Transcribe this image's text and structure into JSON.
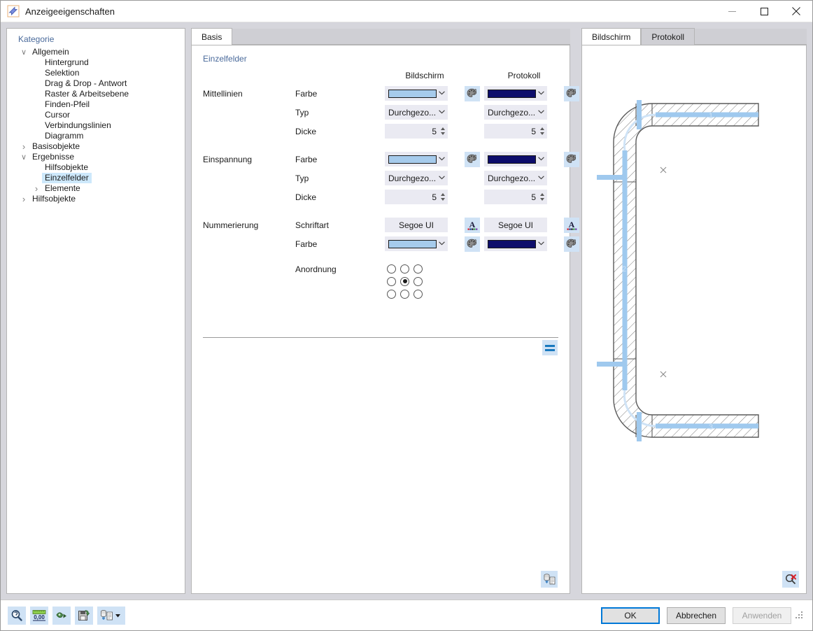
{
  "window": {
    "title": "Anzeigeeigenschaften",
    "app_icon": "arrow-app-icon",
    "minimize_label": "–",
    "maximize_label": "□",
    "close_label": "✕"
  },
  "sidebar": {
    "header": "Kategorie",
    "items": [
      {
        "label": "Allgemein",
        "indent": 0,
        "chevron": "down",
        "selected": false
      },
      {
        "label": "Hintergrund",
        "indent": 1,
        "chevron": "none",
        "selected": false
      },
      {
        "label": "Selektion",
        "indent": 1,
        "chevron": "none",
        "selected": false
      },
      {
        "label": "Drag & Drop - Antwort",
        "indent": 1,
        "chevron": "none",
        "selected": false
      },
      {
        "label": "Raster & Arbeitsebene",
        "indent": 1,
        "chevron": "none",
        "selected": false
      },
      {
        "label": "Finden-Pfeil",
        "indent": 1,
        "chevron": "none",
        "selected": false
      },
      {
        "label": "Cursor",
        "indent": 1,
        "chevron": "none",
        "selected": false
      },
      {
        "label": "Verbindungslinien",
        "indent": 1,
        "chevron": "none",
        "selected": false
      },
      {
        "label": "Diagramm",
        "indent": 1,
        "chevron": "none",
        "selected": false
      },
      {
        "label": "Basisobjekte",
        "indent": 0,
        "chevron": "right",
        "selected": false
      },
      {
        "label": "Ergebnisse",
        "indent": 0,
        "chevron": "down",
        "selected": false
      },
      {
        "label": "Hilfsobjekte",
        "indent": 1,
        "chevron": "none",
        "selected": false
      },
      {
        "label": "Einzelfelder",
        "indent": 1,
        "chevron": "none",
        "selected": true
      },
      {
        "label": "Elemente",
        "indent": 1,
        "chevron": "right",
        "selected": false
      },
      {
        "label": "Hilfsobjekte",
        "indent": 0,
        "chevron": "right",
        "selected": false
      }
    ]
  },
  "main": {
    "tabs": [
      {
        "label": "Basis",
        "active": true
      }
    ],
    "group_label": "Einzelfelder",
    "columns": {
      "screen": "Bildschirm",
      "protocol": "Protokoll"
    },
    "sections": [
      {
        "name": "Mittellinien",
        "rows": [
          {
            "label": "Farbe",
            "type": "color",
            "screen_value": "#a6cbec",
            "protocol_value": "#0d0d6b",
            "has_palette": true
          },
          {
            "label": "Typ",
            "type": "select",
            "screen_value": "Durchgezo...",
            "protocol_value": "Durchgezo...",
            "has_palette": false
          },
          {
            "label": "Dicke",
            "type": "spin",
            "screen_value": "5",
            "protocol_value": "5",
            "has_palette": false
          }
        ]
      },
      {
        "name": "Einspannung",
        "rows": [
          {
            "label": "Farbe",
            "type": "color",
            "screen_value": "#a6cbec",
            "protocol_value": "#0d0d6b",
            "has_palette": true
          },
          {
            "label": "Typ",
            "type": "select",
            "screen_value": "Durchgezo...",
            "protocol_value": "Durchgezo...",
            "has_palette": false
          },
          {
            "label": "Dicke",
            "type": "spin",
            "screen_value": "5",
            "protocol_value": "5",
            "has_palette": false
          }
        ]
      },
      {
        "name": "Nummerierung",
        "rows": [
          {
            "label": "Schriftart",
            "type": "font",
            "screen_value": "Segoe UI",
            "protocol_value": "Segoe UI",
            "has_palette": true
          },
          {
            "label": "Farbe",
            "type": "color",
            "screen_value": "#a6cbec",
            "protocol_value": "#0d0d6b",
            "has_palette": true
          }
        ]
      }
    ],
    "arrangement": {
      "label": "Anordnung",
      "selected_index": 4,
      "cells": [
        0,
        1,
        2,
        3,
        4,
        5,
        6,
        7,
        8
      ]
    },
    "list_button_icon": "equals-list-icon",
    "export_button_icon": "stack-to-document-icon"
  },
  "preview": {
    "tabs": [
      {
        "label": "Bildschirm",
        "active": true
      },
      {
        "label": "Protokoll",
        "active": false
      }
    ],
    "reset_zoom_icon": "zoom-reset-icon",
    "drawing": {
      "name": "hatched-c-frame-with-centerlines",
      "line_color": "#9fc9ee",
      "outline_color": "#5a5a5a",
      "marker_label_top": "1",
      "marker_label_mid": "2",
      "marker_label_bottom": "3"
    }
  },
  "footer": {
    "toolbar": [
      {
        "icon": "search-magnifier-icon",
        "name": "find-button"
      },
      {
        "icon": "ruler-units-icon",
        "name": "units-button",
        "text": "0,00"
      },
      {
        "icon": "import-config-icon",
        "name": "import-button"
      },
      {
        "icon": "save-config-icon",
        "name": "save-button"
      },
      {
        "icon": "stack-document-dropdown-icon",
        "name": "template-dropdown-button"
      }
    ],
    "buttons": [
      {
        "label": "OK",
        "style": "default",
        "name": "ok-button"
      },
      {
        "label": "Abbrechen",
        "style": "normal",
        "name": "cancel-button"
      },
      {
        "label": "Anwenden",
        "style": "disabled",
        "name": "apply-button"
      }
    ]
  },
  "colors": {
    "accent": "#0078d7",
    "group_label": "#4a6a9b",
    "selection": "#cde8fb",
    "icon_bg": "#cfe2f5",
    "field_bg": "#eaeaf2"
  }
}
